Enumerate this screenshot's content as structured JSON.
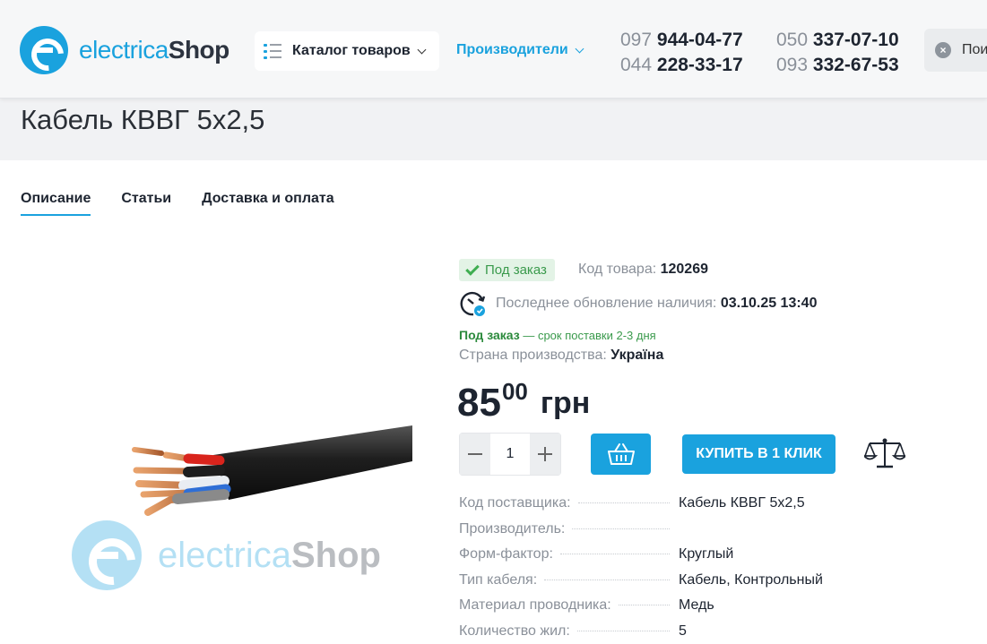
{
  "header": {
    "logo": {
      "part1": "electrica",
      "part2": "Shop"
    },
    "catalog_label": "Каталог товаров",
    "manufacturers_label": "Производители",
    "phones_col1": [
      {
        "code": "097",
        "number": "944-04-77"
      },
      {
        "code": "044",
        "number": "228-33-17"
      }
    ],
    "phones_col2": [
      {
        "code": "050",
        "number": "337-07-10"
      },
      {
        "code": "093",
        "number": "332-67-53"
      }
    ],
    "search_text": "Пои"
  },
  "page": {
    "title": "Кабель КВВГ 5х2,5"
  },
  "tabs": [
    {
      "label": "Описание",
      "active": true
    },
    {
      "label": "Статьи",
      "active": false
    },
    {
      "label": "Доставка и оплата",
      "active": false
    }
  ],
  "watermark": {
    "part1": "electrica",
    "part2": "Shop"
  },
  "product": {
    "status": "Под заказ",
    "sku_label": "Код товара:",
    "sku": "120269",
    "update_label": "Последнее обновление наличия:",
    "update_value": "03.10.25 13:40",
    "delivery_status": "Под заказ",
    "delivery_note": "— срок поставки 2-3 дня",
    "country_label": "Страна производства:",
    "country": "Україна",
    "price_int": "85",
    "price_frac": "00",
    "currency": "грн",
    "qty": "1",
    "buy_one_click": "КУПИТЬ В 1 КЛИК"
  },
  "specs": [
    {
      "name": "Код поставщика:",
      "value": "Кабель КВВГ 5х2,5"
    },
    {
      "name": "Производитель:",
      "value": ""
    },
    {
      "name": "Форм-фактор:",
      "value": "Круглый"
    },
    {
      "name": "Тип кабеля:",
      "value": "Кабель, Контрольный"
    },
    {
      "name": "Материал проводника:",
      "value": "Медь"
    },
    {
      "name": "Количество жил:",
      "value": "5"
    }
  ],
  "colors": {
    "accent": "#1aa2de",
    "success": "#3fae51",
    "dark": "#1d2430",
    "muted": "#8a9099"
  }
}
